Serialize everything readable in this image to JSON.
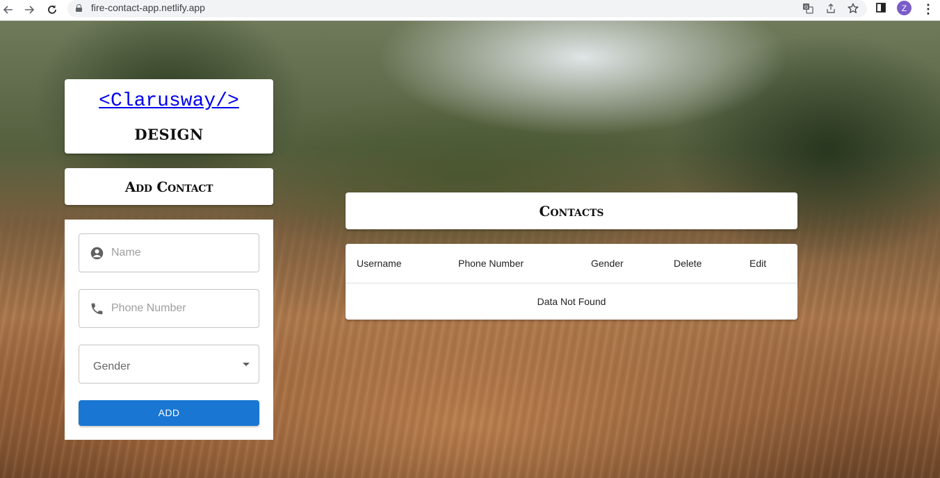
{
  "browser": {
    "url": "fire-contact-app.netlify.app",
    "profile_initial": "Z",
    "icons": [
      "back-arrow-icon",
      "forward-arrow-icon",
      "reload-icon",
      "lock-icon",
      "translate-icon",
      "share-icon",
      "bookmark-star-icon",
      "side-panel-icon",
      "more-menu-icon"
    ]
  },
  "brand": {
    "link_text": "<Clarusway/>",
    "subtitle": "DESIGN"
  },
  "add_contact": {
    "title": "Add Contact",
    "name_placeholder": "Name",
    "phone_placeholder": "Phone Number",
    "gender_label": "Gender",
    "add_button": "ADD"
  },
  "contacts": {
    "title": "Contacts",
    "columns": [
      "Username",
      "Phone Number",
      "Gender",
      "Delete",
      "Edit"
    ],
    "empty_message": "Data Not Found"
  },
  "colors": {
    "accent": "#1976d2",
    "link": "#0000ee",
    "avatar": "#7b5cc9"
  }
}
